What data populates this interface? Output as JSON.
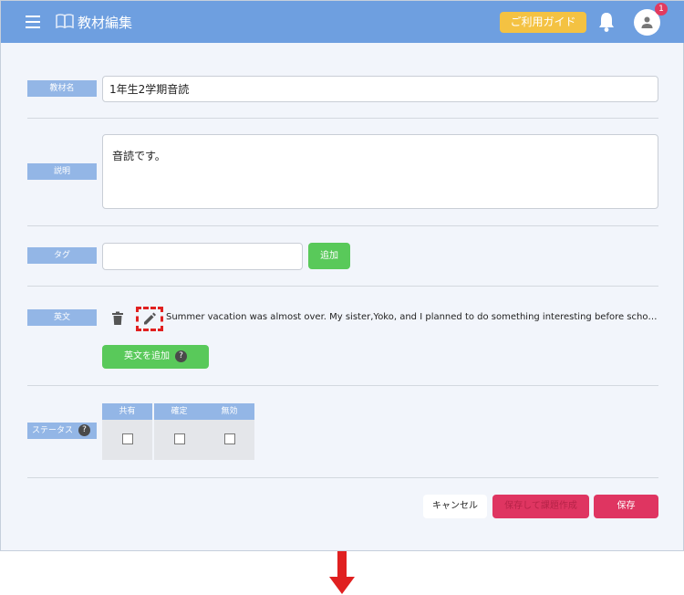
{
  "header": {
    "title": "教材編集",
    "guide_button": "ご利用ガイド",
    "notification_count": "1",
    "bar_color": "#6e9fe0"
  },
  "fields": {
    "name_label": "教材名",
    "name_value": "1年生2学期音読",
    "description_label": "説明",
    "description_value": "音読です。",
    "tag_label": "タグ",
    "tag_value": "",
    "tag_add_button": "追加",
    "english_label": "英文",
    "english_sentence": "Summer vacation was almost over. My sister,Yoko, and I planned to do something interesting before school starte…",
    "english_add_button": "英文を追加",
    "status_label": "ステータス"
  },
  "status_table": {
    "columns": [
      "共有",
      "確定",
      "無効"
    ],
    "checked": [
      false,
      false,
      false
    ]
  },
  "actions": {
    "cancel": "キャンセル",
    "save_and_create": "保存して課題作成",
    "save": "保存"
  },
  "colors": {
    "accent_green": "#59c95a",
    "accent_red": "#df3561",
    "label_blue": "#93b6e6",
    "highlight_red": "#e02020"
  }
}
